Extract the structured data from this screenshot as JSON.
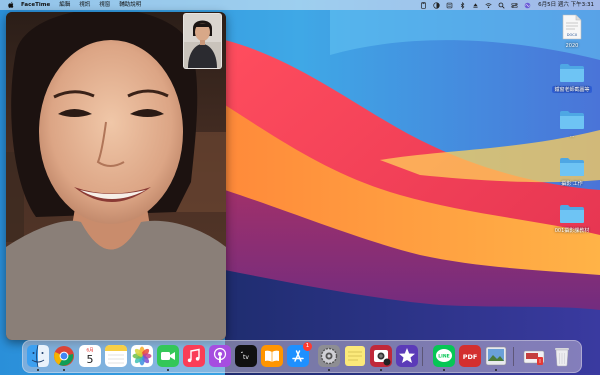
{
  "menubar": {
    "app_name": "FaceTime",
    "menus": [
      "編輯",
      "視訊",
      "視窗",
      "輔助說明"
    ],
    "clock": "6月5日 週六 下午3:31"
  },
  "calendar": {
    "date": "5",
    "month": "6月"
  },
  "appstore_badge": "1",
  "desktop": [
    {
      "label": "2020",
      "kind": "docx",
      "doc_tag": "DOCX"
    },
    {
      "label": "鐵窗老師截圖等",
      "kind": "folder"
    },
    {
      "label": "...",
      "kind": "folder"
    },
    {
      "label": "攝影 工作",
      "kind": "folder"
    },
    {
      "label": "001攝影課教材",
      "kind": "folder"
    }
  ],
  "dock_text": {
    "line": "LINE",
    "pdf": "PDF"
  },
  "colors": {
    "folder": "#5fb8f0",
    "badge": "#ff3b30"
  }
}
